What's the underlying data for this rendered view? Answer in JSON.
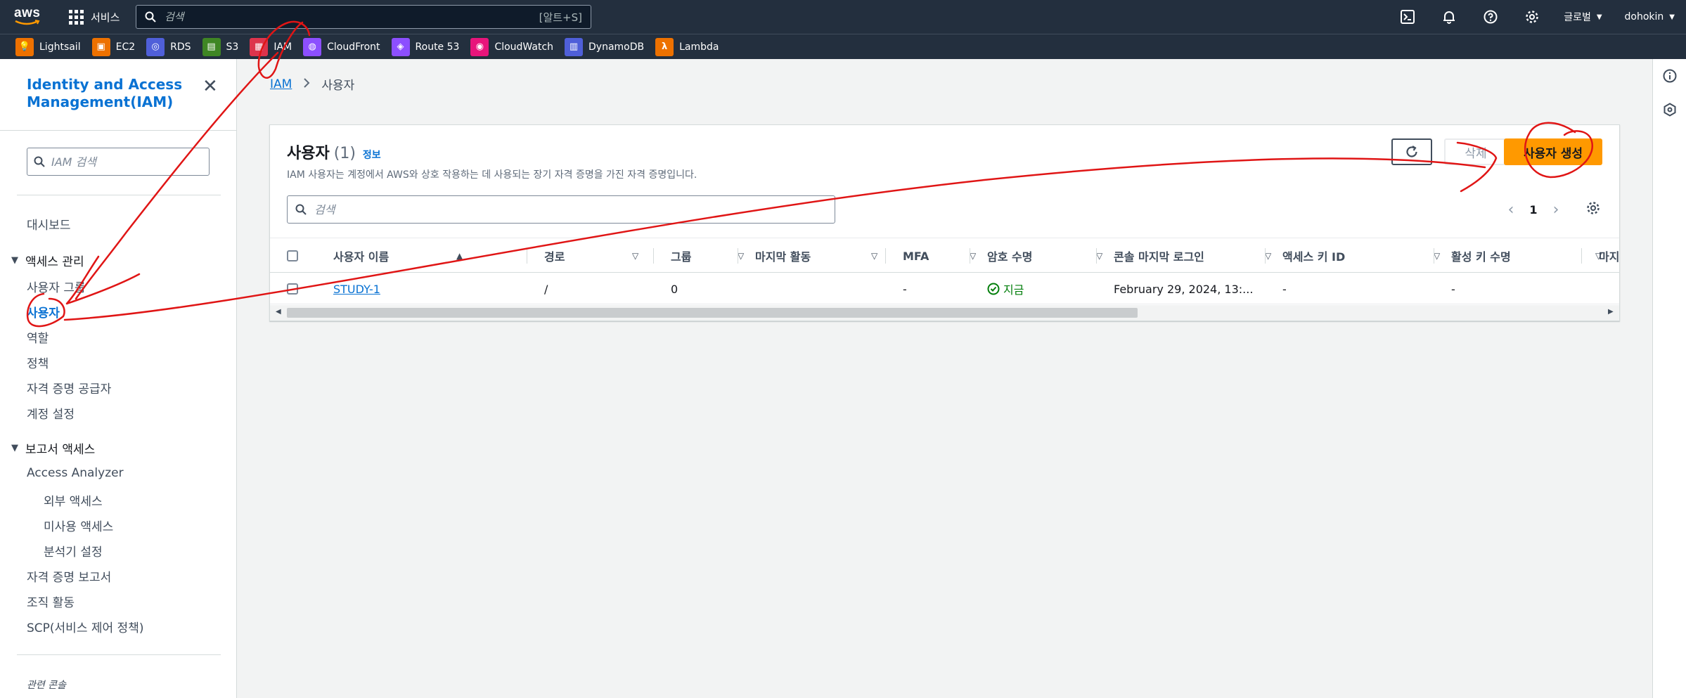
{
  "topnav": {
    "logo": "aws",
    "services_label": "서비스",
    "search_placeholder": "검색",
    "search_shortcut": "[알트+S]",
    "region_label": "글로벌",
    "user_label": "dohokin",
    "icons": [
      "cloudshell-icon",
      "notifications-icon",
      "help-icon",
      "settings-icon"
    ]
  },
  "favorites": [
    {
      "label": "Lightsail",
      "color": "#ed7100"
    },
    {
      "label": "EC2",
      "color": "#ed7100"
    },
    {
      "label": "RDS",
      "color": "#4f5fd9"
    },
    {
      "label": "S3",
      "color": "#3f8624"
    },
    {
      "label": "IAM",
      "color": "#dd344c"
    },
    {
      "label": "CloudFront",
      "color": "#8c4fff"
    },
    {
      "label": "Route 53",
      "color": "#8c4fff"
    },
    {
      "label": "CloudWatch",
      "color": "#e7157b"
    },
    {
      "label": "DynamoDB",
      "color": "#4f5fd9"
    },
    {
      "label": "Lambda",
      "color": "#ed7100"
    }
  ],
  "sidebar": {
    "title": "Identity and Access Management(IAM)",
    "search_placeholder": "IAM 검색",
    "dashboard": "대시보드",
    "access_mgmt": {
      "label": "액세스 관리",
      "items": [
        "사용자 그룹",
        "사용자",
        "역할",
        "정책",
        "자격 증명 공급자",
        "계정 설정"
      ]
    },
    "report_access": {
      "label": "보고서 액세스",
      "items": [
        "Access Analyzer",
        "외부 액세스",
        "미사용 액세스",
        "분석기 설정",
        "자격 증명 보고서",
        "조직 활동",
        "SCP(서비스 제어 정책)"
      ]
    },
    "footer": "관련 콘솔"
  },
  "breadcrumb": {
    "root": "IAM",
    "current": "사용자"
  },
  "users_panel": {
    "title": "사용자",
    "count": "(1)",
    "info": "정보",
    "description": "IAM 사용자는 계정에서 AWS와 상호 작용하는 데 사용되는 장기 자격 증명을 가진 자격 증명입니다.",
    "delete_label": "삭제",
    "create_label": "사용자 생성",
    "search_placeholder": "검색",
    "page": "1",
    "columns": [
      "사용자 이름",
      "경로",
      "그룹",
      "마지막 활동",
      "MFA",
      "암호 수명",
      "콘솔 마지막 로그인",
      "액세스 키 ID",
      "활성 키 수명",
      "마지"
    ],
    "rows": [
      {
        "username": "STUDY-1",
        "path": "/",
        "groups": "0",
        "last_activity": "",
        "mfa": "-",
        "password_age": "지금",
        "console_last_login": "February 29, 2024, 13:...",
        "access_key_id": "-",
        "active_key_age": "-"
      }
    ]
  },
  "colors": {
    "accent": "#0972d3",
    "primary_button": "#ff9900",
    "nav_bg": "#232f3e",
    "annotation": "#e01515"
  }
}
